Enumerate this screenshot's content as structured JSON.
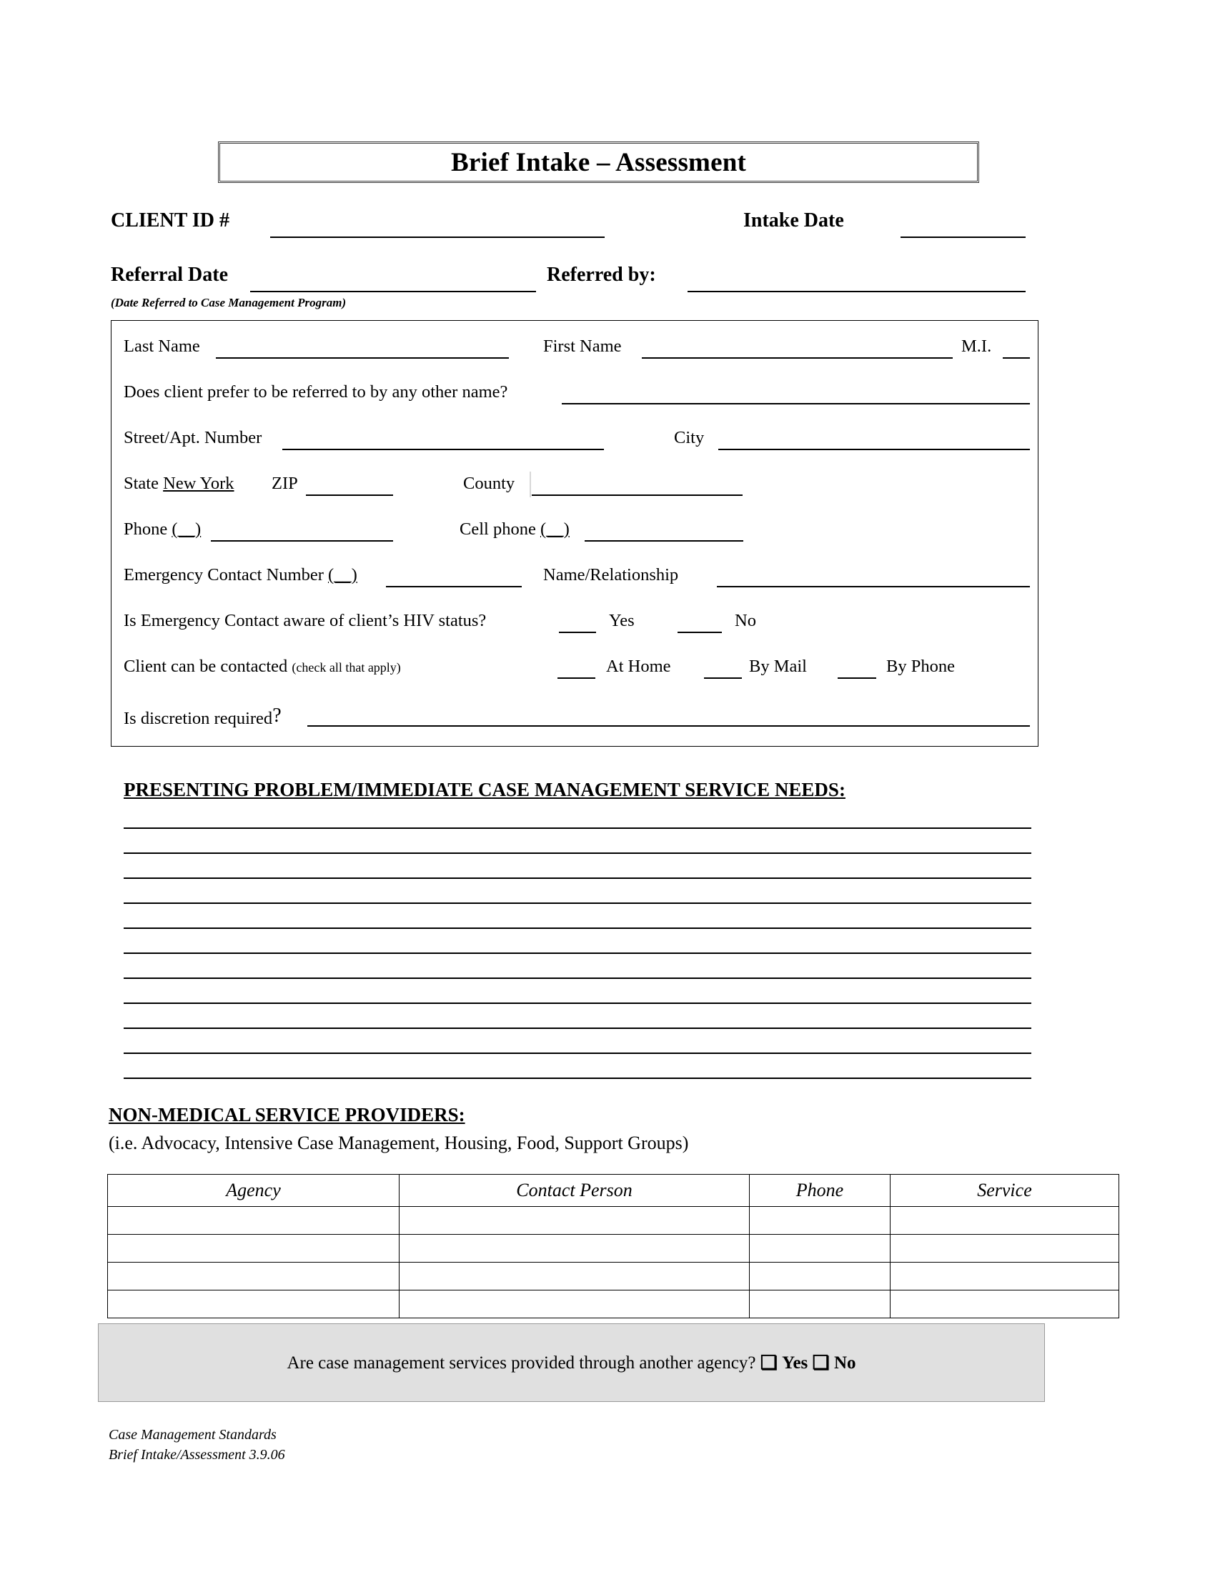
{
  "document": {
    "title": "Brief Intake – Assessment"
  },
  "header": {
    "client_id_label": "CLIENT ID #",
    "intake_date_label": "Intake Date",
    "referral_date_label": "Referral Date",
    "referral_date_note": "(Date Referred to Case Management Program)",
    "referred_by_label": "Referred by:"
  },
  "client_info": {
    "last_name_label": "Last Name",
    "first_name_label": "First Name",
    "middle_initial_label": "M.I.",
    "preferred_name_label": "Does client prefer to be referred to by any other name?",
    "street_label": "Street/Apt. Number",
    "city_label": "City",
    "state_label": "State",
    "state_value": "New York",
    "zip_label": "ZIP",
    "county_label": "County",
    "phone_label": "Phone",
    "phone_area_code": "(__)",
    "cell_phone_label": "Cell phone",
    "cell_area_code": "(__)",
    "emergency_contact_label": "Emergency Contact Number",
    "emergency_area_code": "(__)",
    "name_relationship_label": "Name/Relationship",
    "hiv_aware_label": "Is Emergency Contact aware of client’s HIV status?",
    "hiv_yes": "Yes",
    "hiv_no": "No",
    "contact_label": "Client can be contacted",
    "contact_note": "(check all that apply)",
    "contact_at_home": "At Home",
    "contact_by_mail": "By Mail",
    "contact_by_phone": "By Phone",
    "discretion_label": "Is discretion required",
    "discretion_qmark": "?"
  },
  "presenting_problem": {
    "heading": "PRESENTING PROBLEM/IMMEDIATE CASE MANAGEMENT SERVICE NEEDS:",
    "line_count": 11
  },
  "non_medical_providers": {
    "heading": "NON-MEDICAL SERVICE PROVIDERS:",
    "subheading": "(i.e. Advocacy, Intensive Case Management, Housing, Food, Support Groups)",
    "columns": [
      "Agency",
      "Contact Person",
      "Phone",
      "Service"
    ],
    "rows": [
      [
        "",
        "",
        "",
        ""
      ],
      [
        "",
        "",
        "",
        ""
      ],
      [
        "",
        "",
        "",
        ""
      ],
      [
        "",
        "",
        "",
        ""
      ]
    ]
  },
  "another_agency": {
    "question": "Are case management services provided through another agency?",
    "checkbox_glyph": "❏",
    "yes_label": "Yes",
    "no_label": "No",
    "background_color": "#e0e0e0"
  },
  "footer": {
    "line1": "Case Management Standards",
    "line2": "Brief Intake/Assessment 3.9.06"
  }
}
